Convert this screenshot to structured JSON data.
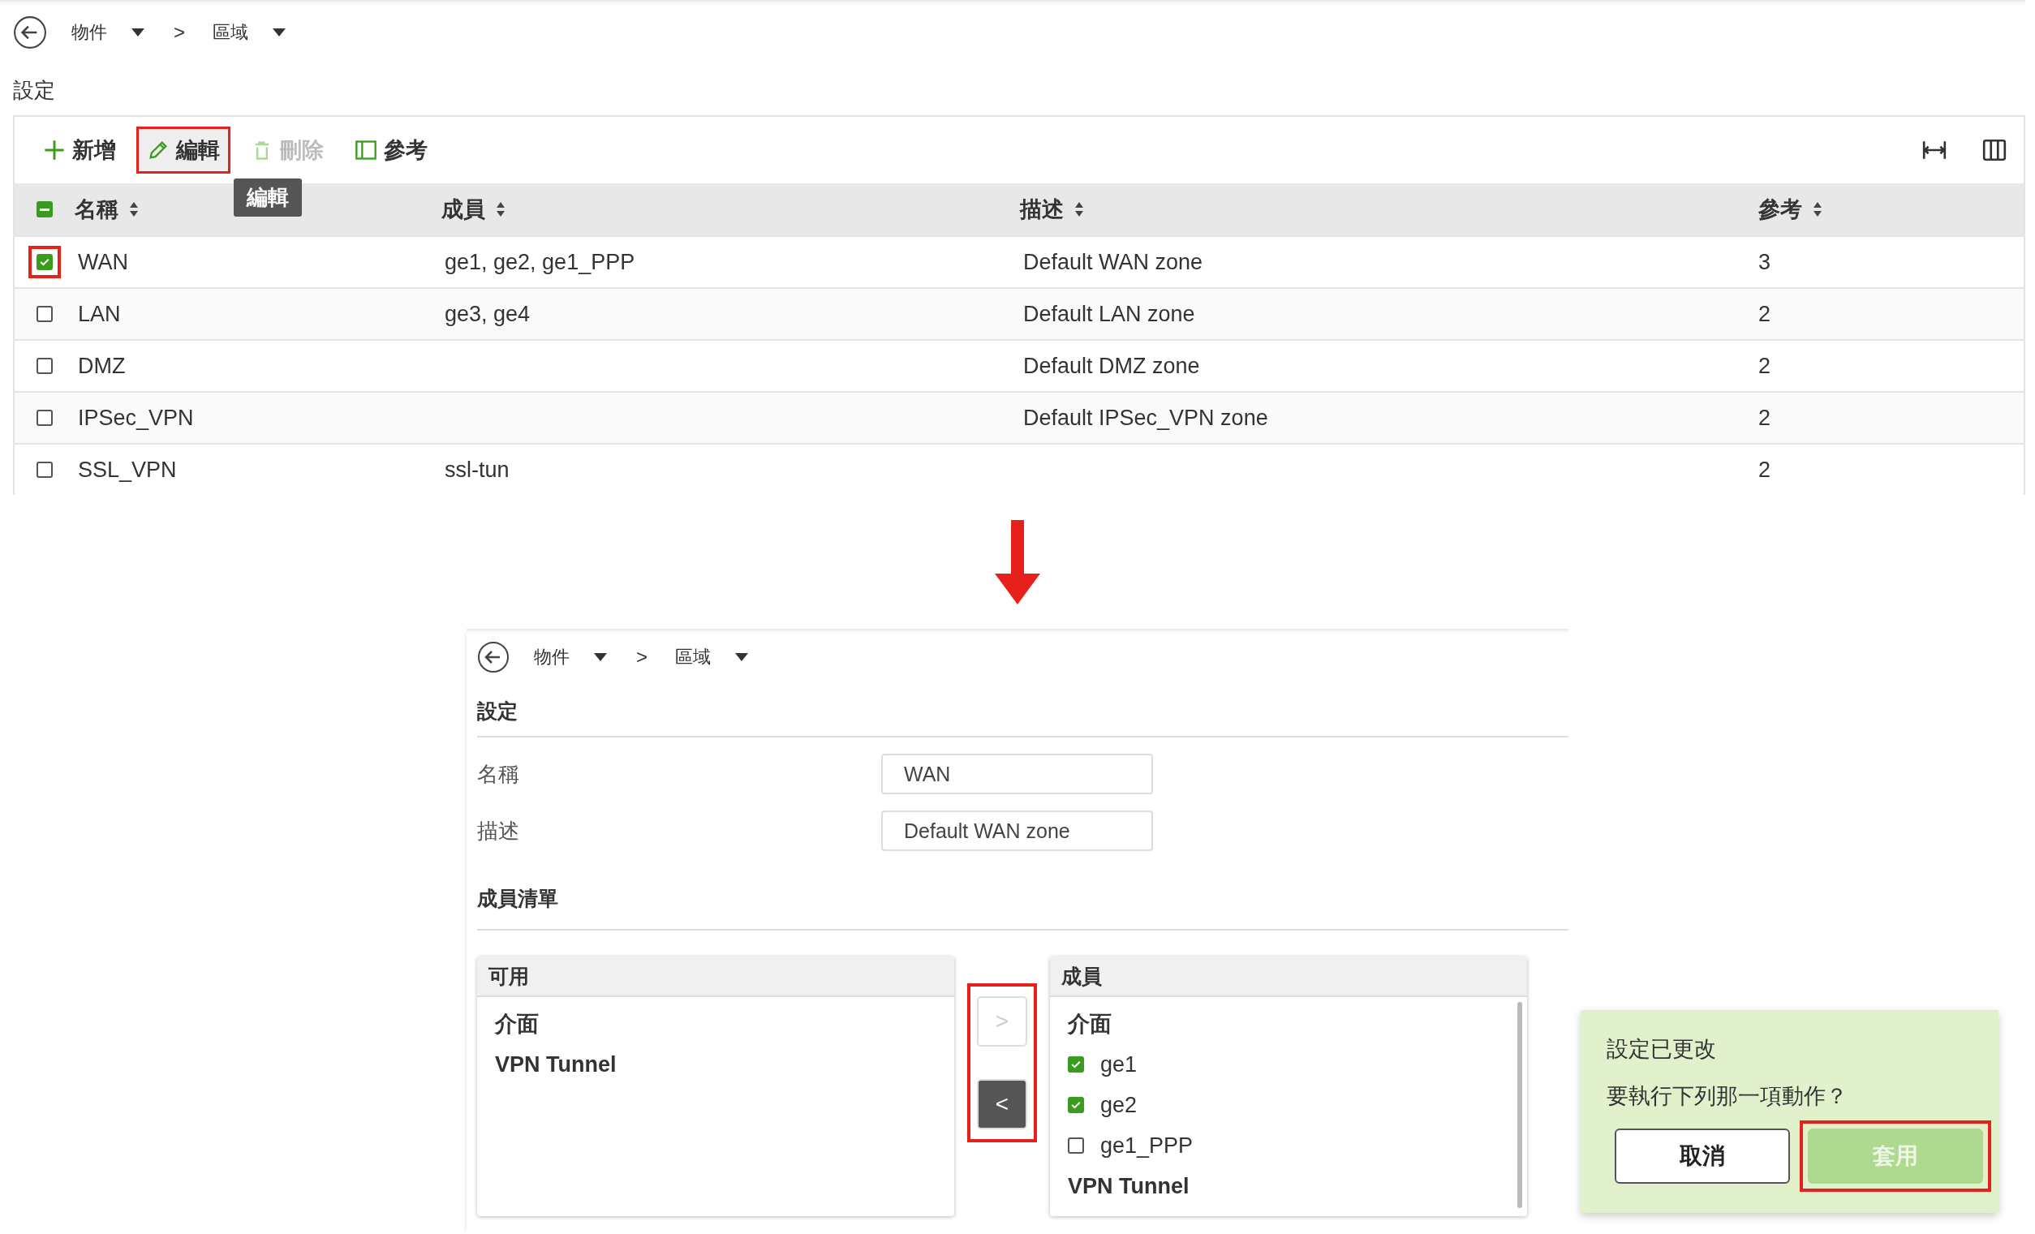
{
  "breadcrumb": {
    "items": [
      {
        "label": "物件"
      },
      {
        "label": "區域"
      }
    ],
    "separator": ">"
  },
  "section_title": "設定",
  "toolbar": [
    {
      "label": "新增",
      "kind": "add",
      "disabled": false,
      "highlighted": false
    },
    {
      "label": "編輯",
      "kind": "edit",
      "disabled": false,
      "highlighted": true
    },
    {
      "label": "刪除",
      "kind": "delete",
      "disabled": true,
      "highlighted": false
    },
    {
      "label": "參考",
      "kind": "reference",
      "disabled": false,
      "highlighted": false
    }
  ],
  "tooltip": "編輯",
  "table": {
    "select_all_indeterminate": true,
    "columns": [
      "名稱",
      "成員",
      "描述",
      "參考"
    ],
    "rows": [
      {
        "name": "WAN",
        "members": "ge1, ge2, ge1_PPP",
        "description": "Default WAN zone",
        "references": "3",
        "checked": true,
        "highlighted": true
      },
      {
        "name": "LAN",
        "members": "ge3, ge4",
        "description": "Default LAN zone",
        "references": "2",
        "checked": false,
        "highlighted": false
      },
      {
        "name": "DMZ",
        "members": "",
        "description": "Default DMZ zone",
        "references": "2",
        "checked": false,
        "highlighted": false
      },
      {
        "name": "IPSec_VPN",
        "members": "",
        "description": "Default IPSec_VPN zone",
        "references": "2",
        "checked": false,
        "highlighted": false
      },
      {
        "name": "SSL_VPN",
        "members": "ssl-tun",
        "description": "",
        "references": "2",
        "checked": false,
        "highlighted": false
      }
    ]
  },
  "edit_page": {
    "breadcrumb": {
      "items": [
        {
          "label": "物件"
        },
        {
          "label": "區域"
        }
      ],
      "separator": ">"
    },
    "section_title": "設定",
    "fields": [
      {
        "label": "名稱",
        "value": "WAN"
      },
      {
        "label": "描述",
        "value": "Default WAN zone"
      }
    ],
    "member_list_title": "成員清單",
    "available": {
      "title": "可用",
      "items": [
        {
          "kind": "group",
          "label": "介面"
        },
        {
          "kind": "group",
          "label": "VPN Tunnel"
        }
      ]
    },
    "transfer_buttons": [
      {
        "label": ">",
        "disabled": true
      },
      {
        "label": "<",
        "disabled": false
      }
    ],
    "transfer_highlighted": true,
    "members": {
      "title": "成員",
      "items": [
        {
          "kind": "group",
          "label": "介面"
        },
        {
          "kind": "item",
          "label": "ge1",
          "checked": true
        },
        {
          "kind": "item",
          "label": "ge2",
          "checked": true
        },
        {
          "kind": "item",
          "label": "ge1_PPP",
          "checked": false
        },
        {
          "kind": "group",
          "label": "VPN Tunnel"
        }
      ]
    }
  },
  "dialog": {
    "title": "設定已更改",
    "message": "要執行下列那一項動作？",
    "buttons": [
      {
        "label": "取消",
        "kind": "secondary",
        "highlighted": false
      },
      {
        "label": "套用",
        "kind": "primary",
        "highlighted": true
      }
    ]
  }
}
